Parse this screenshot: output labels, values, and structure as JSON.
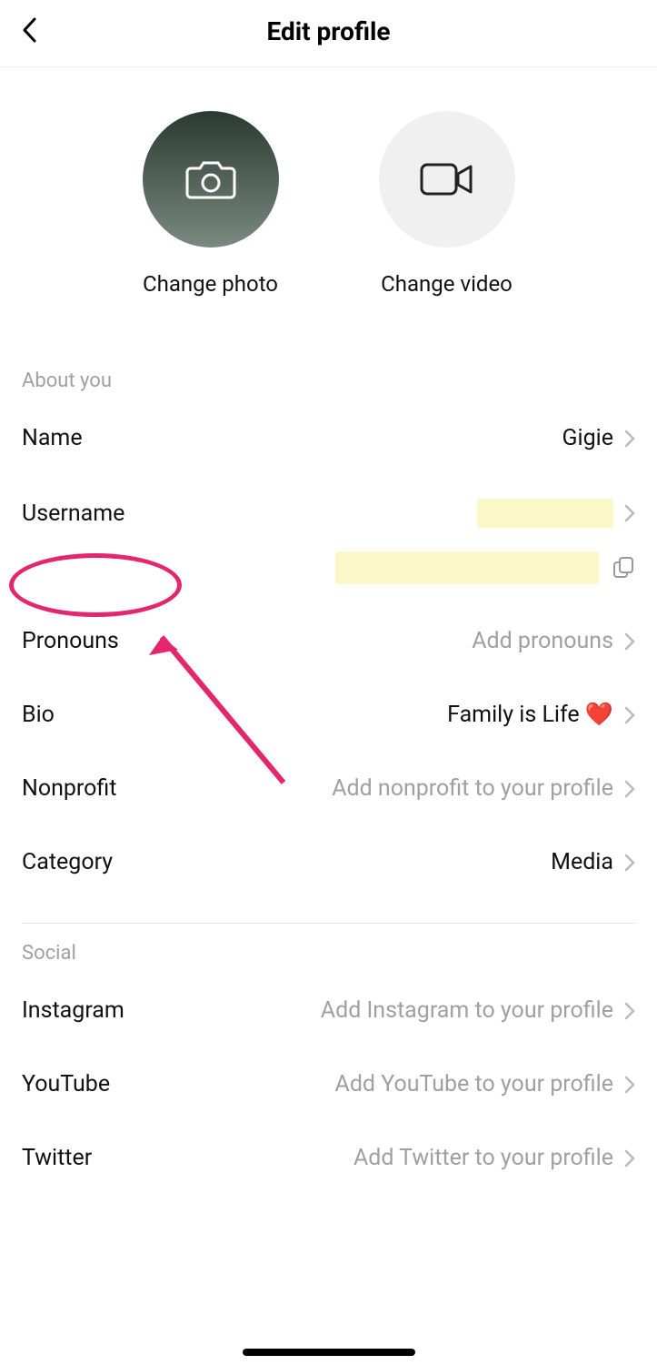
{
  "header": {
    "title": "Edit profile"
  },
  "media": {
    "change_photo_label": "Change photo",
    "change_video_label": "Change video"
  },
  "sections": {
    "about_title": "About you",
    "social_title": "Social"
  },
  "rows": {
    "name": {
      "label": "Name",
      "value": "Gigie"
    },
    "username": {
      "label": "Username",
      "value": ""
    },
    "pronouns": {
      "label": "Pronouns",
      "value": "Add pronouns",
      "is_placeholder": true
    },
    "bio": {
      "label": "Bio",
      "value": "Family is Life ❤️"
    },
    "nonprofit": {
      "label": "Nonprofit",
      "value": "Add nonprofit to your profile",
      "is_placeholder": true
    },
    "category": {
      "label": "Category",
      "value": "Media"
    },
    "instagram": {
      "label": "Instagram",
      "value": "Add Instagram to your profile",
      "is_placeholder": true
    },
    "youtube": {
      "label": "YouTube",
      "value": "Add YouTube to your profile",
      "is_placeholder": true
    },
    "twitter": {
      "label": "Twitter",
      "value": "Add Twitter to your profile",
      "is_placeholder": true
    }
  }
}
